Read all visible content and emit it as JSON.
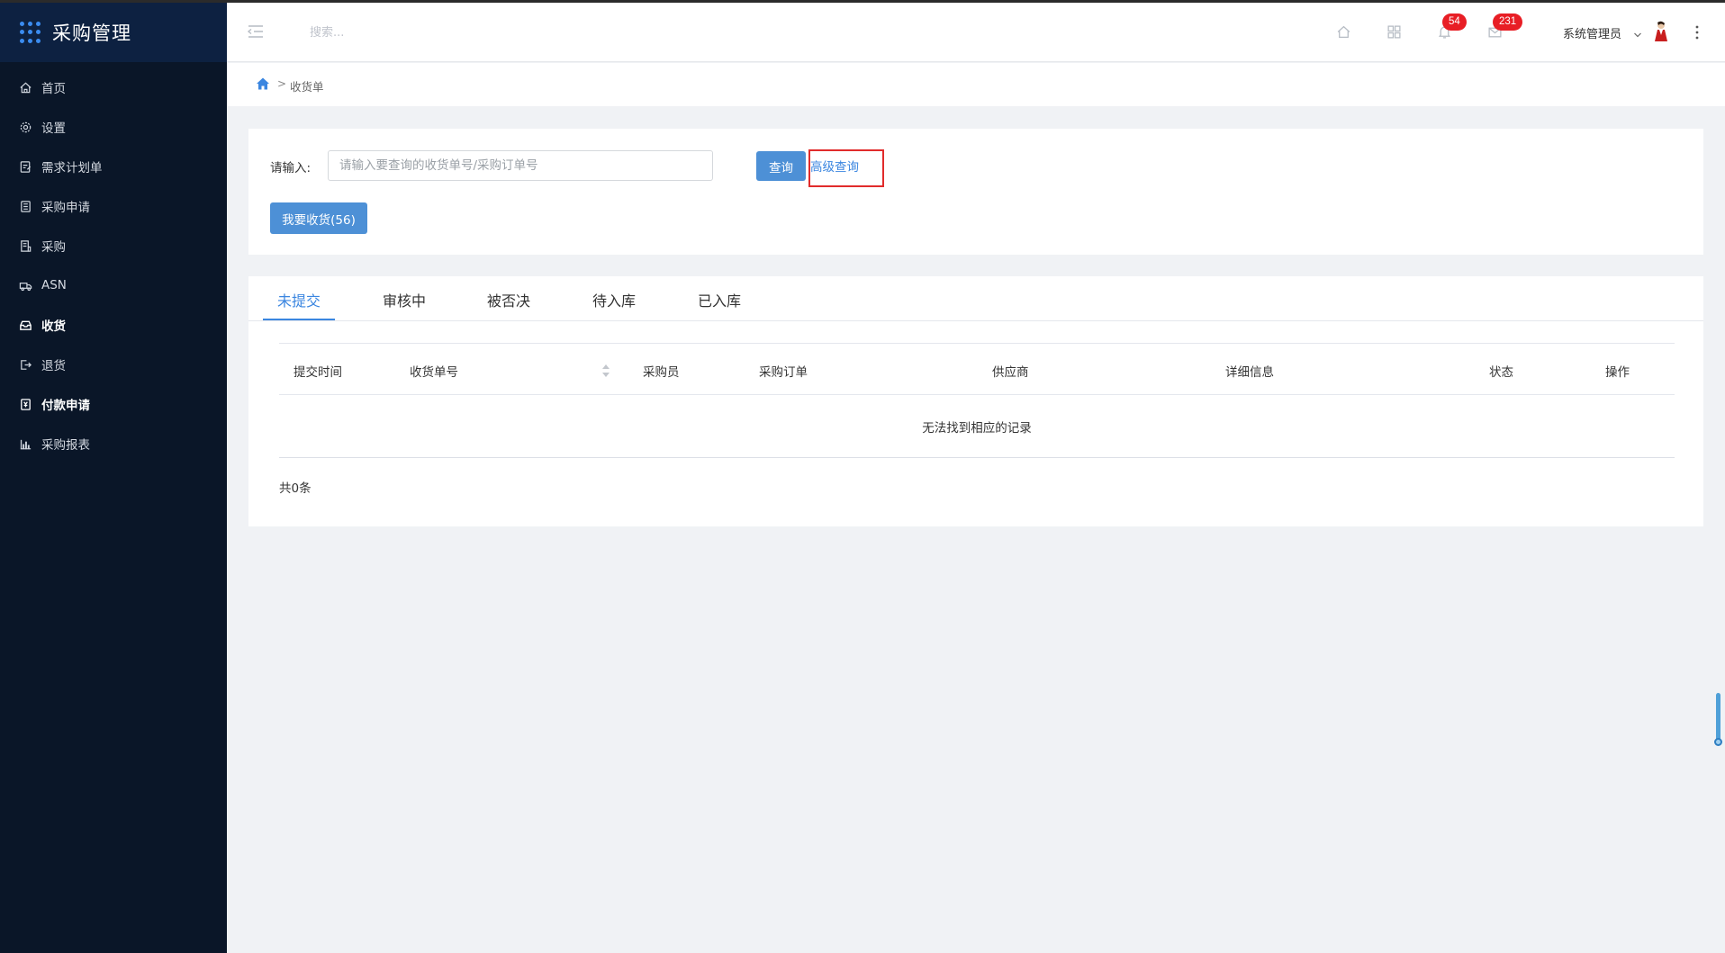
{
  "app": {
    "title": "采购管理"
  },
  "sidebar": {
    "items": [
      {
        "label": "首页",
        "icon": "home-icon",
        "bold": false
      },
      {
        "label": "设置",
        "icon": "gear-icon",
        "bold": false
      },
      {
        "label": "需求计划单",
        "icon": "plan-icon",
        "bold": false
      },
      {
        "label": "采购申请",
        "icon": "document-icon",
        "bold": false
      },
      {
        "label": "采购",
        "icon": "cart-doc-icon",
        "bold": false
      },
      {
        "label": "ASN",
        "icon": "truck-icon",
        "bold": false
      },
      {
        "label": "收货",
        "icon": "inbox-icon",
        "bold": true
      },
      {
        "label": "退货",
        "icon": "return-icon",
        "bold": false
      },
      {
        "label": "付款申请",
        "icon": "payment-icon",
        "bold": true
      },
      {
        "label": "采购报表",
        "icon": "bar-chart-icon",
        "bold": false
      }
    ]
  },
  "header": {
    "search_placeholder": "搜索...",
    "notifications_badge": "54",
    "messages_badge": "231",
    "user_name": "系统管理员"
  },
  "breadcrumb": {
    "separator": ">",
    "current": "收货单"
  },
  "search_panel": {
    "label": "请输入:",
    "input_placeholder": "请输入要查询的收货单号/采购订单号",
    "search_button": "查询",
    "advanced_link": "高级查询",
    "receive_button": "我要收货(56)"
  },
  "tabs": [
    "未提交",
    "审核中",
    "被否决",
    "待入库",
    "已入库"
  ],
  "active_tab": 0,
  "table": {
    "columns": [
      "提交时间",
      "收货单号",
      "采购员",
      "采购订单",
      "供应商",
      "详细信息",
      "状态",
      "操作"
    ],
    "empty_text": "无法找到相应的记录",
    "total_text": "共0条"
  },
  "colors": {
    "sidebar_bg": "#0a1628",
    "accent": "#3b86e0",
    "button": "#4d90d6",
    "badge": "#e81e25",
    "highlight_box": "#e12b2b"
  }
}
